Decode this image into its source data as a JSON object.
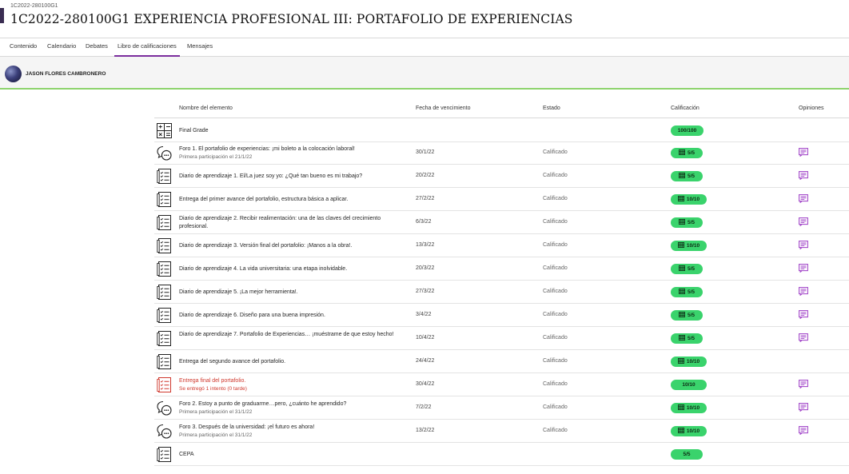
{
  "course": {
    "code": "1C2022-280100G1",
    "title": "1C2022-280100G1 EXPERIENCIA PROFESIONAL III: PORTAFOLIO DE EXPERIENCIAS"
  },
  "tabs": [
    "Contenido",
    "Calendario",
    "Debates",
    "Libro de calificaciones",
    "Mensajes"
  ],
  "active_tab": "Libro de calificaciones",
  "user": {
    "name": "JASON FLORES CAMBRONERO"
  },
  "table": {
    "headers": {
      "name": "Nombre del elemento",
      "due": "Fecha de vencimiento",
      "status": "Estado",
      "grade": "Calificación",
      "feedback": "Opiniones"
    },
    "rows": [
      {
        "icon": "calculator-icon",
        "title": "Final Grade",
        "sub": "",
        "due": "",
        "status": "",
        "grade": "100/100",
        "grade_icon": false,
        "feedback": false,
        "late": false
      },
      {
        "icon": "discussion-icon",
        "title": "Foro 1. El portafolio de experiencias: ¡mi boleto a la colocación laboral!",
        "sub": "Primera participación el 21/1/22",
        "due": "30/1/22",
        "status": "Calificado",
        "grade": "5/5",
        "grade_icon": true,
        "feedback": true,
        "late": false
      },
      {
        "icon": "assignment-icon",
        "title": "Diario de aprendizaje 1. El/La juez soy yo: ¿Qué tan bueno es mi trabajo?",
        "sub": "",
        "due": "20/2/22",
        "status": "Calificado",
        "grade": "5/5",
        "grade_icon": true,
        "feedback": true,
        "late": false
      },
      {
        "icon": "assignment-icon",
        "title": "Entrega del primer avance del portafolio, estructura básica a aplicar.",
        "sub": "",
        "due": "27/2/22",
        "status": "Calificado",
        "grade": "10/10",
        "grade_icon": true,
        "feedback": true,
        "late": false
      },
      {
        "icon": "assignment-icon",
        "title": "Diario de aprendizaje 2. Recibir realimentación: una de las claves del crecimiento profesional.",
        "sub": "",
        "due": "6/3/22",
        "status": "Calificado",
        "grade": "5/5",
        "grade_icon": true,
        "feedback": true,
        "late": false
      },
      {
        "icon": "assignment-icon",
        "title": "Diario de aprendizaje 3. Versión final del portafolio: ¡Manos a la obra!.",
        "sub": "",
        "due": "13/3/22",
        "status": "Calificado",
        "grade": "10/10",
        "grade_icon": true,
        "feedback": true,
        "late": false
      },
      {
        "icon": "assignment-icon",
        "title": "Diario de aprendizaje 4. La vida universitaria: una etapa inolvidable.",
        "sub": "",
        "due": "20/3/22",
        "status": "Calificado",
        "grade": "5/5",
        "grade_icon": true,
        "feedback": true,
        "late": false
      },
      {
        "icon": "assignment-icon",
        "title": "Diario de aprendizaje 5. ¡La mejor herramienta!.",
        "sub": "",
        "due": "27/3/22",
        "status": "Calificado",
        "grade": "5/5",
        "grade_icon": true,
        "feedback": true,
        "late": false
      },
      {
        "icon": "assignment-icon",
        "title": "Diario de aprendizaje 6. Diseño para una buena impresión.",
        "sub": "",
        "due": "3/4/22",
        "status": "Calificado",
        "grade": "5/5",
        "grade_icon": true,
        "feedback": true,
        "late": false
      },
      {
        "icon": "assignment-icon",
        "title": "Diario de aprendizaje 7. Portafolio de Experiencias… ¡muéstrame de que estoy hecho!",
        "sub": "",
        "due": "10/4/22",
        "status": "Calificado",
        "grade": "5/5",
        "grade_icon": true,
        "feedback": true,
        "late": false
      },
      {
        "icon": "assignment-icon",
        "title": "Entrega del segundo avance del portafolio.",
        "sub": "",
        "due": "24/4/22",
        "status": "Calificado",
        "grade": "10/10",
        "grade_icon": true,
        "feedback": false,
        "late": false
      },
      {
        "icon": "assignment-late-icon",
        "title": "Entrega final del portafolio.",
        "sub": "Se entregó 1 intento (0 tarde)",
        "due": "30/4/22",
        "status": "Calificado",
        "grade": "10/10",
        "grade_icon": false,
        "feedback": true,
        "late": true
      },
      {
        "icon": "discussion-icon",
        "title": "Foro 2. Estoy a punto de graduarme…pero, ¿cuánto he aprendido?",
        "sub": "Primera participación el 31/1/22",
        "due": "7/2/22",
        "status": "Calificado",
        "grade": "10/10",
        "grade_icon": true,
        "feedback": true,
        "late": false
      },
      {
        "icon": "discussion-icon",
        "title": "Foro 3. Después de la universidad: ¡el futuro es ahora!",
        "sub": "Primera participación el 31/1/22",
        "due": "13/2/22",
        "status": "Calificado",
        "grade": "10/10",
        "grade_icon": true,
        "feedback": true,
        "late": false
      },
      {
        "icon": "assignment-icon",
        "title": "CEPA",
        "sub": "",
        "due": "",
        "status": "",
        "grade": "5/5",
        "grade_icon": false,
        "feedback": false,
        "late": false
      }
    ]
  },
  "colors": {
    "accent": "#7b2d9e",
    "grade_pill": "#3ad36c",
    "late": "#d0392e",
    "feedback_icon": "#a349c9",
    "user_bar_border": "#8ed36d"
  }
}
